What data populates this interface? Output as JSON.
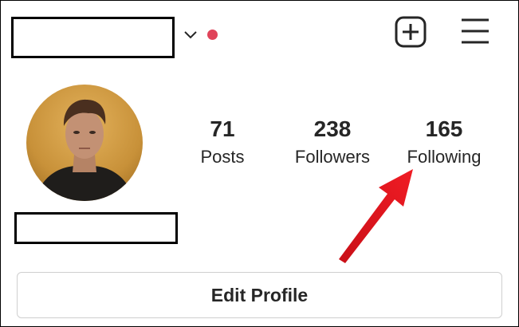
{
  "header": {
    "username_redacted": true,
    "chevron_icon": "chevron-down-icon",
    "notification_dot_color": "#e0445a",
    "new_post_icon": "plus-square-icon",
    "menu_icon": "hamburger-menu-icon"
  },
  "profile": {
    "avatar_icon": "profile-photo",
    "stats": [
      {
        "value": "71",
        "label": "Posts"
      },
      {
        "value": "238",
        "label": "Followers"
      },
      {
        "value": "165",
        "label": "Following"
      }
    ],
    "name_redacted": true
  },
  "annotation": {
    "arrow_color": "#e8141e",
    "target": "Following"
  },
  "actions": {
    "edit_profile_label": "Edit Profile"
  }
}
